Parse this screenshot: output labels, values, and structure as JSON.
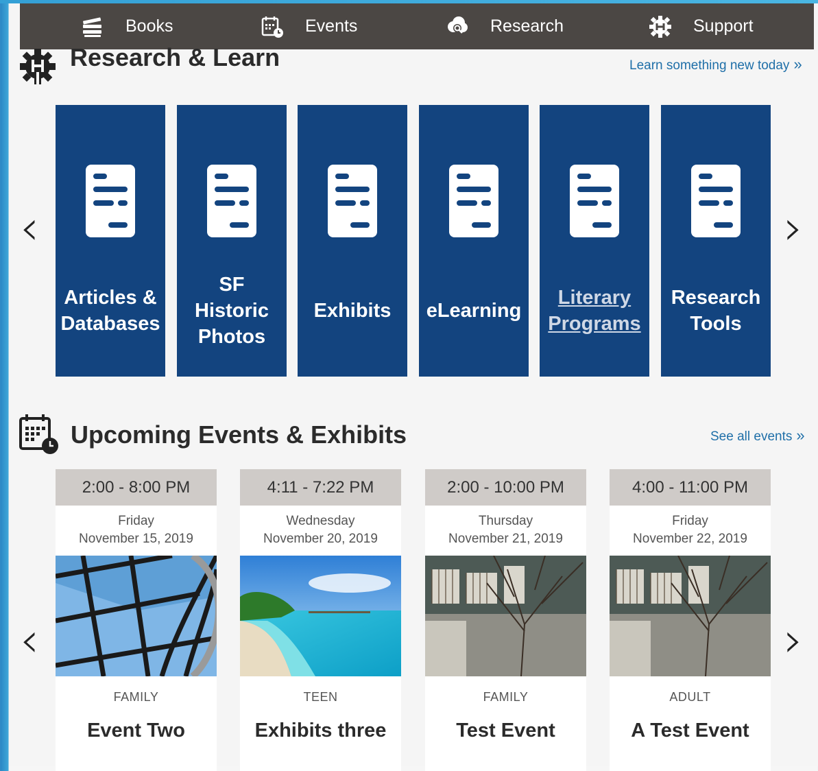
{
  "nav": {
    "items": [
      {
        "label": "Books",
        "icon": "books-icon"
      },
      {
        "label": "Events",
        "icon": "calendar-clock-icon"
      },
      {
        "label": "Research",
        "icon": "research-cloud-icon"
      },
      {
        "label": "Support",
        "icon": "gear-hands-icon"
      }
    ]
  },
  "research": {
    "title": "Research & Learn",
    "link": "Learn something new today",
    "link_chevron": "»",
    "tiles": [
      {
        "label": "Articles &\nDatabases"
      },
      {
        "label": "SF\nHistoric\nPhotos"
      },
      {
        "label": "Exhibits"
      },
      {
        "label": "eLearning"
      },
      {
        "label": "Literary\nPrograms"
      },
      {
        "label": "Research\nTools"
      }
    ],
    "tile_color": "#13447f",
    "prev_arrow": "‹",
    "next_arrow": "›"
  },
  "events": {
    "title": "Upcoming Events & Exhibits",
    "link": "See all events",
    "link_chevron": "»",
    "prev_arrow": "‹",
    "next_arrow": "›",
    "cards": [
      {
        "time": "2:00 - 8:00 PM",
        "day": "Friday",
        "date": "November 15, 2019",
        "category": "FAMILY",
        "name": "Event Two",
        "image": "glass-dome-photo"
      },
      {
        "time": "4:11 - 7:22 PM",
        "day": "Wednesday",
        "date": "November 20, 2019",
        "category": "TEEN",
        "name": "Exhibits three",
        "image": "beach-photo"
      },
      {
        "time": "2:00 - 10:00 PM",
        "day": "Thursday",
        "date": "November 21, 2019",
        "category": "FAMILY",
        "name": "Test Event",
        "image": "library-courtyard-photo"
      },
      {
        "time": "4:00 - 11:00 PM",
        "day": "Friday",
        "date": "November 22, 2019",
        "category": "ADULT",
        "name": "A Test Event",
        "image": "library-courtyard-photo"
      }
    ]
  }
}
